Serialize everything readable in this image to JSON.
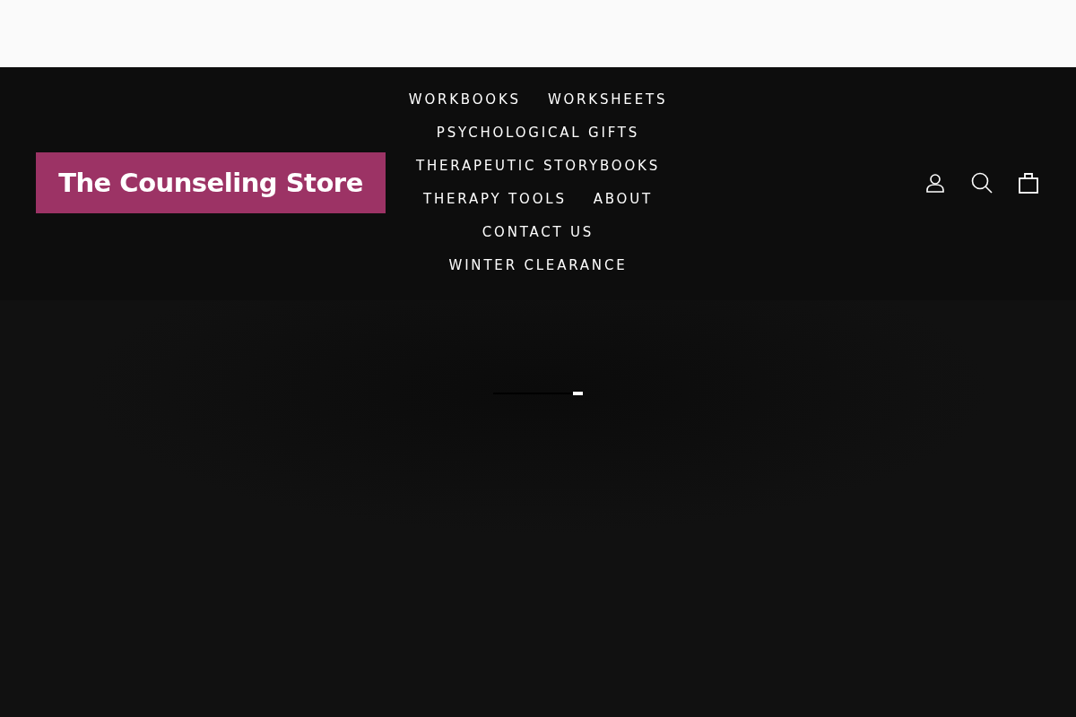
{
  "header": {
    "logo": "The Counseling Store",
    "nav_rows": [
      [
        "WORKBOOKS",
        "WORKSHEETS"
      ],
      [
        "PSYCHOLOGICAL GIFTS"
      ],
      [
        "THERAPEUTIC STORYBOOKS"
      ],
      [
        "THERAPY TOOLS",
        "ABOUT"
      ],
      [
        "CONTACT US"
      ],
      [
        "WINTER CLEARANCE"
      ]
    ]
  }
}
